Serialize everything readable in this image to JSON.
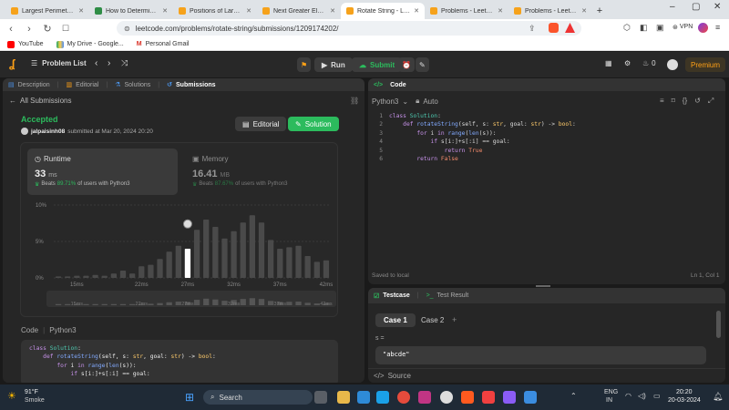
{
  "browser": {
    "tabs": [
      {
        "title": "Largest Perimeter Triangl",
        "icon": "leetcode-icon",
        "active": false
      },
      {
        "title": "How to Determine if Thre",
        "icon": "gfg-icon",
        "active": false
      },
      {
        "title": "Positions of Large Groups",
        "icon": "leetcode-icon",
        "active": false
      },
      {
        "title": "Next Greater Element III",
        "icon": "leetcode-icon",
        "active": false
      },
      {
        "title": "Rotate String - LeetC",
        "icon": "leetcode-icon",
        "active": true
      },
      {
        "title": "Problems - LeetCode",
        "icon": "leetcode-icon",
        "active": false
      },
      {
        "title": "Problems - LeetCode",
        "icon": "leetcode-icon",
        "active": false
      }
    ],
    "url": "leetcode.com/problems/rotate-string/submissions/1209174202/",
    "vpn": "VPN",
    "bookmarks": [
      "YouTube",
      "My Drive - Google...",
      "Personal Gmail"
    ]
  },
  "nav": {
    "problem_list": "Problem List",
    "run": "Run",
    "submit": "Submit",
    "streak": "0",
    "premium": "Premium"
  },
  "left": {
    "tabs": [
      "Description",
      "Editorial",
      "Solutions",
      "Submissions"
    ],
    "back": "All Submissions",
    "status": "Accepted",
    "user": "jalpaisinh08",
    "submitted": "submitted at Mar 20, 2024 20:20",
    "editorial_btn": "Editorial",
    "solution_btn": "Solution",
    "runtime": {
      "label": "Runtime",
      "value": "33",
      "unit": "ms",
      "beats_pre": "Beats",
      "beats": "89.71%",
      "beats_post": "of users with Python3"
    },
    "memory": {
      "label": "Memory",
      "value": "16.41",
      "unit": "MB",
      "beats_pre": "Beats",
      "beats": "87.67%",
      "beats_post": "of users with Python3"
    },
    "code_label": "Code",
    "lang": "Python3"
  },
  "chart_data": {
    "type": "bar",
    "title": "",
    "ylabel": "",
    "y_ticks": [
      "10%",
      "5%",
      "0%"
    ],
    "ylim": [
      0,
      10
    ],
    "x_ticks": [
      "15ms",
      "22ms",
      "27ms",
      "32ms",
      "37ms",
      "42ms"
    ],
    "x_start": 13,
    "values": [
      0.2,
      0.2,
      0.3,
      0.3,
      0.4,
      0.3,
      0.6,
      1.0,
      0.6,
      1.6,
      1.8,
      2.6,
      3.6,
      4.4,
      4.0,
      6.6,
      8.0,
      7.0,
      5.4,
      6.4,
      7.6,
      8.6,
      7.6,
      5.2,
      4.0,
      4.2,
      4.4,
      3.0,
      2.2,
      2.4
    ],
    "highlight_index": 14,
    "marker_value": 7.4
  },
  "right": {
    "title": "Code",
    "lang": "Python3",
    "auto": "Auto",
    "saved": "Saved to local",
    "cursor": "Ln 1, Col 1"
  },
  "test": {
    "tab1": "Testcase",
    "tab2": "Test Result",
    "case1": "Case 1",
    "case2": "Case 2",
    "var": "s =",
    "value": "\"abcde\"",
    "source": "Source"
  },
  "taskbar": {
    "temp": "91°F",
    "weather": "Smoke",
    "search": "Search",
    "lang": "ENG",
    "region": "IN",
    "time": "20:20",
    "date": "20-03-2024"
  },
  "colors": {
    "accent": "#2cbb5d",
    "orange": "#ffa116",
    "bg": "#1a1a1a",
    "panel": "#262626"
  }
}
